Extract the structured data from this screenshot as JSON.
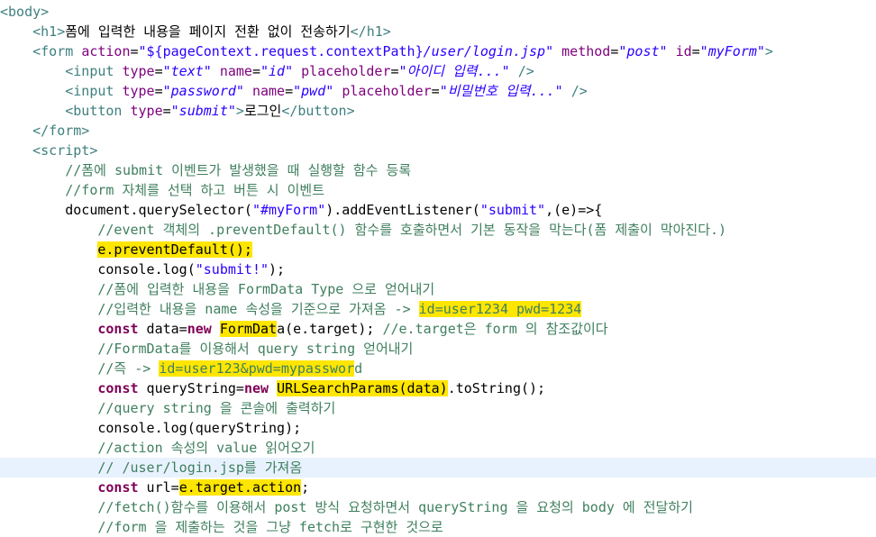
{
  "editor": {
    "highlight_color": "#ffe600",
    "current_line_color": "#e8f2fe",
    "current_line_index": 23,
    "lines": [
      [
        {
          "t": "<body>",
          "c": "tag"
        }
      ],
      [
        {
          "t": "    "
        },
        {
          "t": "<h1>",
          "c": "tag"
        },
        {
          "t": "폼에 입력한 내용을 페이지 전환 없이 전송하기"
        },
        {
          "t": "</h1>",
          "c": "tag"
        }
      ],
      [
        {
          "t": "    "
        },
        {
          "t": "<form",
          "c": "tag"
        },
        {
          "t": " "
        },
        {
          "t": "action",
          "c": "attr"
        },
        {
          "t": "="
        },
        {
          "t": "\"${pageContext.request.contextPath}",
          "c": "str"
        },
        {
          "t": "/user/login.jsp\"",
          "c": "val"
        },
        {
          "t": " "
        },
        {
          "t": "method",
          "c": "attr"
        },
        {
          "t": "="
        },
        {
          "t": "\"post\"",
          "c": "val"
        },
        {
          "t": " "
        },
        {
          "t": "id",
          "c": "attr"
        },
        {
          "t": "="
        },
        {
          "t": "\"myForm\"",
          "c": "val"
        },
        {
          "t": ">",
          "c": "tag"
        }
      ],
      [
        {
          "t": "        "
        },
        {
          "t": "<input",
          "c": "tag"
        },
        {
          "t": " "
        },
        {
          "t": "type",
          "c": "attr"
        },
        {
          "t": "="
        },
        {
          "t": "\"text\"",
          "c": "val"
        },
        {
          "t": " "
        },
        {
          "t": "name",
          "c": "attr"
        },
        {
          "t": "="
        },
        {
          "t": "\"id\"",
          "c": "val"
        },
        {
          "t": " "
        },
        {
          "t": "placeholder",
          "c": "attr"
        },
        {
          "t": "="
        },
        {
          "t": "\"아이디 입력...\"",
          "c": "val"
        },
        {
          "t": " "
        },
        {
          "t": "/>",
          "c": "tag"
        }
      ],
      [
        {
          "t": "        "
        },
        {
          "t": "<input",
          "c": "tag"
        },
        {
          "t": " "
        },
        {
          "t": "type",
          "c": "attr"
        },
        {
          "t": "="
        },
        {
          "t": "\"password\"",
          "c": "val"
        },
        {
          "t": " "
        },
        {
          "t": "name",
          "c": "attr"
        },
        {
          "t": "="
        },
        {
          "t": "\"pwd\"",
          "c": "val"
        },
        {
          "t": " "
        },
        {
          "t": "placeholder",
          "c": "attr"
        },
        {
          "t": "="
        },
        {
          "t": "\"비밀번호 입력...\"",
          "c": "val"
        },
        {
          "t": " "
        },
        {
          "t": "/>",
          "c": "tag"
        }
      ],
      [
        {
          "t": "        "
        },
        {
          "t": "<button",
          "c": "tag"
        },
        {
          "t": " "
        },
        {
          "t": "type",
          "c": "attr"
        },
        {
          "t": "="
        },
        {
          "t": "\"submit\"",
          "c": "val"
        },
        {
          "t": ">",
          "c": "tag"
        },
        {
          "t": "로그인"
        },
        {
          "t": "</button>",
          "c": "tag"
        }
      ],
      [
        {
          "t": "    "
        },
        {
          "t": "</form>",
          "c": "tag"
        }
      ],
      [
        {
          "t": "    "
        },
        {
          "t": "<script>",
          "c": "tag"
        }
      ],
      [
        {
          "t": "        "
        },
        {
          "t": "//폼에 submit 이벤트가 발생했을 때 실행할 함수 등록",
          "c": "cmt"
        }
      ],
      [
        {
          "t": "        "
        },
        {
          "t": "//form 자체를 선택 하고 버튼 시 이벤트",
          "c": "cmt"
        }
      ],
      [
        {
          "t": "        document.querySelector("
        },
        {
          "t": "\"#myForm\"",
          "c": "str"
        },
        {
          "t": ").addEventListener("
        },
        {
          "t": "\"submit\"",
          "c": "str"
        },
        {
          "t": ",(e)=>{"
        }
      ],
      [
        {
          "t": "            "
        },
        {
          "t": "//event 객체의 .preventDefault() 함수를 호출하면서 기본 동작을 막는다(폼 제출이 막아진다.)",
          "c": "cmt"
        }
      ],
      [
        {
          "t": "            "
        },
        {
          "t": "e.preventDefault();",
          "c": "hl"
        }
      ],
      [
        {
          "t": "            console.log("
        },
        {
          "t": "\"submit!\"",
          "c": "str"
        },
        {
          "t": ");"
        }
      ],
      [
        {
          "t": "            "
        },
        {
          "t": "//폼에 입력한 내용을 FormData Type 으로 얻어내기",
          "c": "cmt"
        }
      ],
      [
        {
          "t": "            "
        },
        {
          "t": "//입력한 내용을 name 속성을 기준으로 가져옴 -> ",
          "c": "cmt"
        },
        {
          "t": "id=user1234 pwd=1234",
          "c": "cmt hl"
        }
      ],
      [
        {
          "t": "            "
        },
        {
          "t": "const",
          "c": "kw"
        },
        {
          "t": " data="
        },
        {
          "t": "new",
          "c": "kw"
        },
        {
          "t": " "
        },
        {
          "t": "FormDat",
          "c": "hl"
        },
        {
          "t": "a(e.target); "
        },
        {
          "t": "//e.target은 form 의 참조값이다",
          "c": "cmt"
        }
      ],
      [
        {
          "t": "            "
        },
        {
          "t": "//FormData를 이용해서 query string 얻어내기",
          "c": "cmt"
        }
      ],
      [
        {
          "t": "            "
        },
        {
          "t": "//즉 -> ",
          "c": "cmt"
        },
        {
          "t": "id=user123&pwd=mypasswor",
          "c": "cmt hl"
        },
        {
          "t": "d",
          "c": "cmt"
        }
      ],
      [
        {
          "t": "            "
        },
        {
          "t": "const",
          "c": "kw"
        },
        {
          "t": " queryString="
        },
        {
          "t": "new",
          "c": "kw"
        },
        {
          "t": " "
        },
        {
          "t": "URLSearchParams(data)",
          "c": "hl"
        },
        {
          "t": ".toString();"
        }
      ],
      [
        {
          "t": "            "
        },
        {
          "t": "//query string 을 콘솔에 출력하기",
          "c": "cmt"
        }
      ],
      [
        {
          "t": "            console.log(queryString);"
        }
      ],
      [
        {
          "t": "            "
        },
        {
          "t": "//action 속성의 value 읽어오기",
          "c": "cmt"
        }
      ],
      [
        {
          "t": "            "
        },
        {
          "t": "// /user/login.jsp를 가져옴",
          "c": "cmt"
        }
      ],
      [
        {
          "t": "            "
        },
        {
          "t": "const",
          "c": "kw"
        },
        {
          "t": " url="
        },
        {
          "t": "e.target.action",
          "c": "hl"
        },
        {
          "t": ";"
        }
      ],
      [
        {
          "t": "            "
        },
        {
          "t": "//fetch()함수를 이용해서 post 방식 요청하면서 queryString 을 요청의 body 에 전달하기",
          "c": "cmt"
        }
      ],
      [
        {
          "t": "            "
        },
        {
          "t": "//form 을 제출하는 것을 그냥 fetch로 구현한 것으로",
          "c": "cmt"
        }
      ]
    ]
  }
}
